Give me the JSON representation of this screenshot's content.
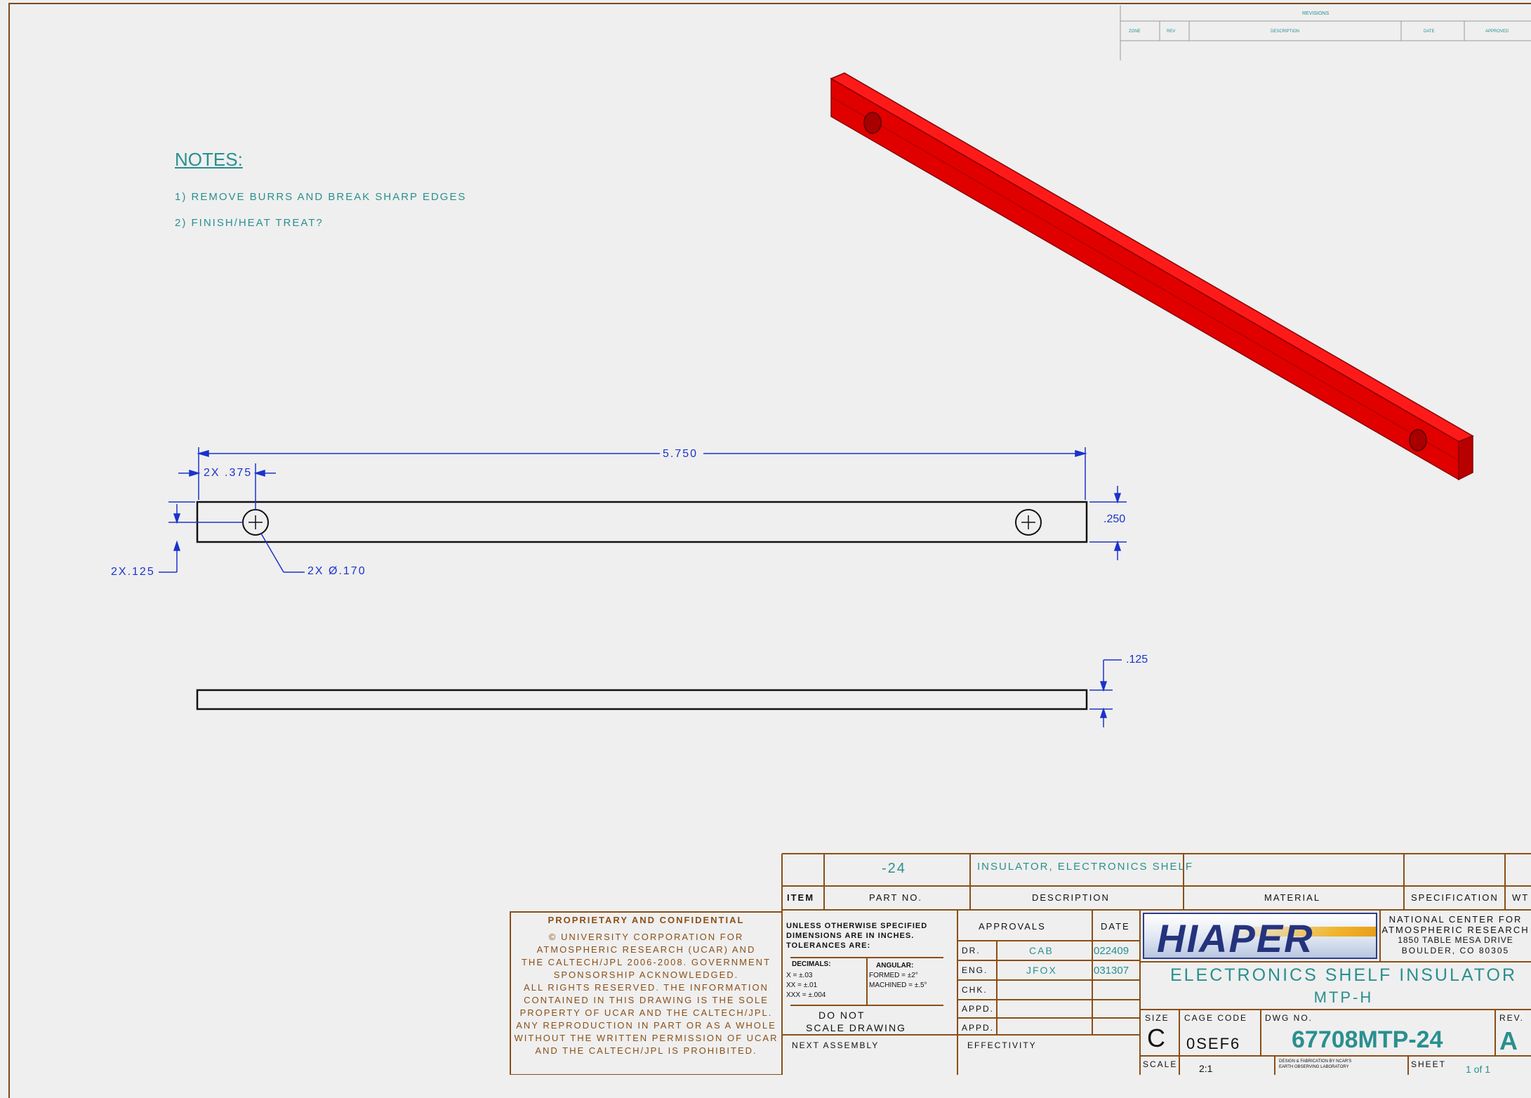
{
  "revisions": {
    "title": "REVISIONS",
    "columns": [
      "ZONE",
      "REV",
      "DESCRIPTION",
      "DATE",
      "APPROVED"
    ]
  },
  "notes": {
    "heading": "NOTES:",
    "items": [
      "1) REMOVE BURRS AND BREAK SHARP EDGES",
      "2) FINISH/HEAT TREAT?"
    ]
  },
  "dimensions": {
    "overall_length": "5.750",
    "hole_offset": "2X .375",
    "hole_edge": "2X.125",
    "hole_diameter": "2X Ø.170",
    "width": ".250",
    "thickness": ".125"
  },
  "bom": {
    "item": "",
    "part_no": "-24",
    "description": "INSULATOR, ELECTRONICS SHELF",
    "material": "",
    "specification": "",
    "headers": {
      "item": "ITEM",
      "part_no": "PART NO.",
      "description": "DESCRIPTION",
      "material": "MATERIAL",
      "specification": "SPECIFICATION",
      "weight": "WT"
    }
  },
  "proprietary": {
    "title": "PROPRIETARY AND CONFIDENTIAL",
    "lines": [
      "© UNIVERSITY CORPORATION FOR",
      "ATMOSPHERIC RESEARCH (UCAR) AND",
      "THE CALTECH/JPL 2006-2008.  GOVERNMENT",
      "SPONSORSHIP ACKNOWLEDGED.",
      "ALL RIGHTS RESERVED. THE INFORMATION",
      "CONTAINED IN THIS DRAWING IS THE SOLE",
      "PROPERTY OF UCAR AND THE CALTECH/JPL.",
      "ANY REPRODUCTION IN PART OR AS A WHOLE",
      "WITHOUT THE WRITTEN PERMISSION OF UCAR",
      "AND THE CALTECH/JPL IS PROHIBITED."
    ]
  },
  "tolerances": {
    "header_lines": [
      "UNLESS OTHERWISE SPECIFIED",
      "DIMENSIONS ARE IN INCHES.",
      "TOLERANCES ARE:"
    ],
    "decimals_label": "DECIMALS:",
    "decimals": [
      "X = ±.03",
      "XX = ±.01",
      "XXX = ±.004"
    ],
    "angular_label": "ANGULAR:",
    "angular": [
      "FORMED = ±2°",
      "MACHINED = ±.5°"
    ],
    "do_not_scale": [
      "DO NOT",
      "SCALE DRAWING"
    ],
    "next_assembly": "NEXT ASSEMBLY",
    "effectivity": "EFFECTIVITY"
  },
  "approvals": {
    "header": "APPROVALS",
    "date_header": "DATE",
    "rows": [
      {
        "role": "DR.",
        "name": "CAB",
        "date": "022409"
      },
      {
        "role": "ENG.",
        "name": "JFOX",
        "date": "031307"
      },
      {
        "role": "CHK.",
        "name": "",
        "date": ""
      },
      {
        "role": "APPD.",
        "name": "",
        "date": ""
      },
      {
        "role": "APPD.",
        "name": "",
        "date": ""
      }
    ]
  },
  "title_block": {
    "logo": "HIAPER",
    "org_lines": [
      "NATIONAL CENTER FOR",
      "ATMOSPHERIC RESEARCH",
      "1850 TABLE MESA DRIVE",
      "BOULDER, CO 80305"
    ],
    "title_line1": "ELECTRONICS SHELF INSULATOR",
    "title_line2": "MTP-H",
    "size_label": "SIZE",
    "size": "C",
    "cage_label": "CAGE CODE",
    "cage": "0SEF6",
    "dwg_label": "DWG NO.",
    "dwg_no": "67708MTP-24",
    "rev_label": "REV.",
    "rev": "A",
    "scale_label": "SCALE",
    "scale": "2:1",
    "fine_print": [
      "DESIGN & FABRICATION BY NCAR'S",
      "EARTH OBSERVING LABORATORY"
    ],
    "sheet_label": "SHEET",
    "sheet": "1 of 1"
  },
  "colors": {
    "part": "#e60000",
    "dimension": "#1a33cc",
    "annotation": "#2a8f8f",
    "border": "#7a4a1e"
  }
}
